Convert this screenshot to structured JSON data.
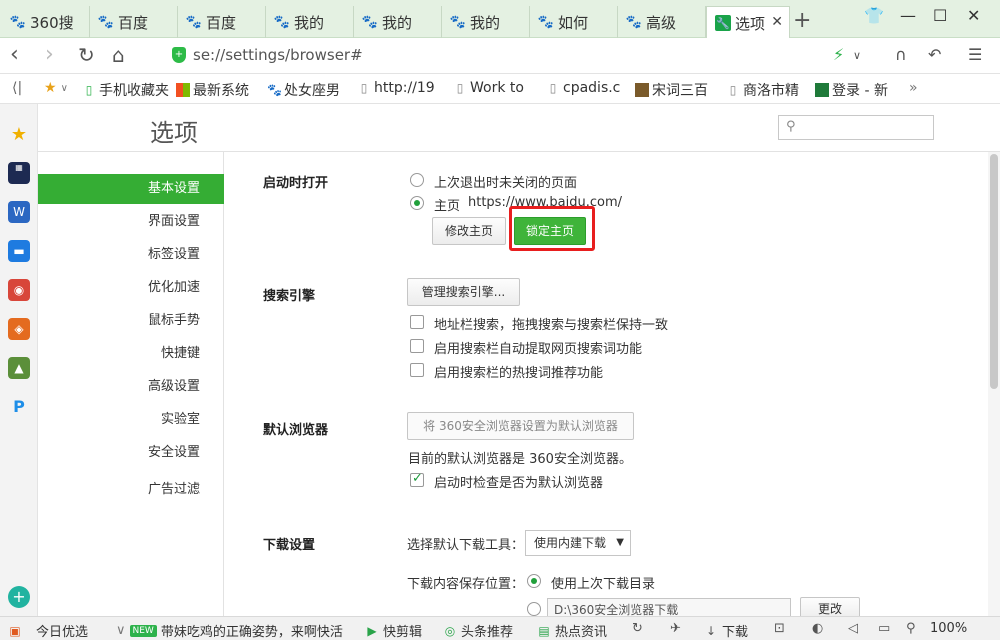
{
  "tabs": [
    {
      "label": "360搜",
      "icon": "paw-icon"
    },
    {
      "label": "百度",
      "icon": "paw-icon"
    },
    {
      "label": "百度",
      "icon": "paw-icon"
    },
    {
      "label": "我的",
      "icon": "paw-icon"
    },
    {
      "label": "我的",
      "icon": "paw-icon"
    },
    {
      "label": "我的",
      "icon": "paw-icon"
    },
    {
      "label": "如何",
      "icon": "paw-icon"
    },
    {
      "label": "高级",
      "icon": "paw-icon"
    },
    {
      "label": "选项",
      "icon": "wrench-icon",
      "active": true
    }
  ],
  "address": {
    "url": "se://settings/browser#"
  },
  "bookmarks": [
    "手机收藏夹",
    "最新系统",
    "处女座男",
    "http://19",
    "Work to",
    "cpadis.c",
    "宋词三百",
    "商洛市精",
    "登录 - 新"
  ],
  "page": {
    "title": "选项",
    "search_placeholder": ""
  },
  "sidebar": {
    "items": [
      "基本设置",
      "界面设置",
      "标签设置",
      "优化加速",
      "鼠标手势",
      "快捷键",
      "高级设置",
      "实验室",
      "安全设置",
      "广告过滤"
    ]
  },
  "startup": {
    "heading": "启动时打开",
    "option_restore": "上次退出时未关闭的页面",
    "option_home": "主页",
    "home_url": "https://www.baidu.com/",
    "edit_home_btn": "修改主页",
    "lock_home_btn": "锁定主页"
  },
  "search": {
    "heading": "搜索引擎",
    "manage_btn": "管理搜索引擎...",
    "opt1": "地址栏搜索，拖拽搜索与搜索栏保持一致",
    "opt2": "启用搜索栏自动提取网页搜索词功能",
    "opt3": "启用搜索栏的热搜词推荐功能"
  },
  "default_browser": {
    "heading": "默认浏览器",
    "set_btn": "将 360安全浏览器设置为默认浏览器",
    "status": "目前的默认浏览器是 360安全浏览器。",
    "check_on_start": "启动时检查是否为默认浏览器"
  },
  "download": {
    "heading": "下载设置",
    "tool_label": "选择默认下载工具：",
    "tool_value": "使用内建下载",
    "location_label": "下载内容保存位置：",
    "opt_last": "使用上次下载目录",
    "path": "D:\\360安全浏览器下载",
    "change_btn": "更改"
  },
  "statusbar": {
    "daily": "今日优选",
    "new_badge": "NEW",
    "news": "带妹吃鸡的正确姿势，来啊快活",
    "clip": "快剪辑",
    "headline": "头条推荐",
    "hot": "热点资讯",
    "download": "下载",
    "zoom": "100%"
  }
}
